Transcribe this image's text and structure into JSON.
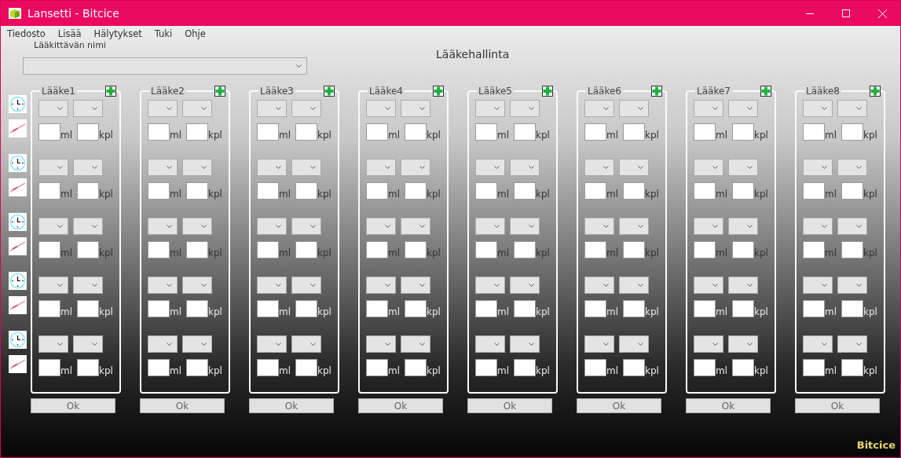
{
  "window": {
    "title": "Lansetti - Bitcice"
  },
  "menu": [
    "Tiedosto",
    "Lisää",
    "Hälytykset",
    "Tuki",
    "Ohje"
  ],
  "patient": {
    "label": "Lääkittävän nimi"
  },
  "heading": "Lääkehallinta",
  "medicines": [
    {
      "name": "Lääke1",
      "slots": [
        {
          "unit_1": "ml",
          "unit_2": "kpl"
        },
        {
          "unit_1": "ml",
          "unit_2": "kpl"
        },
        {
          "unit_1": "ml",
          "unit_2": "kpl"
        },
        {
          "unit_1": "ml",
          "unit_2": "kpl"
        },
        {
          "unit_1": "ml",
          "unit_2": "kpl"
        }
      ],
      "button": "Ok"
    },
    {
      "name": "Lääke2",
      "slots": [
        {
          "unit_1": "ml",
          "unit_2": "kpl"
        },
        {
          "unit_1": "ml",
          "unit_2": "kpl"
        },
        {
          "unit_1": "ml",
          "unit_2": "kpl"
        },
        {
          "unit_1": "ml",
          "unit_2": "kpl"
        },
        {
          "unit_1": "ml",
          "unit_2": "kpl"
        }
      ],
      "button": "Ok"
    },
    {
      "name": "Lääke3",
      "slots": [
        {
          "unit_1": "ml",
          "unit_2": "kpl"
        },
        {
          "unit_1": "ml",
          "unit_2": "kpl"
        },
        {
          "unit_1": "ml",
          "unit_2": "kpl"
        },
        {
          "unit_1": "ml",
          "unit_2": "kpl"
        },
        {
          "unit_1": "ml",
          "unit_2": "kpl"
        }
      ],
      "button": "Ok"
    },
    {
      "name": "Lääke4",
      "slots": [
        {
          "unit_1": "ml",
          "unit_2": "kpl"
        },
        {
          "unit_1": "ml",
          "unit_2": "kpl"
        },
        {
          "unit_1": "ml",
          "unit_2": "kpl"
        },
        {
          "unit_1": "ml",
          "unit_2": "kpl"
        },
        {
          "unit_1": "ml",
          "unit_2": "kpl"
        }
      ],
      "button": "Ok"
    },
    {
      "name": "Lääke5",
      "slots": [
        {
          "unit_1": "ml",
          "unit_2": "kpl"
        },
        {
          "unit_1": "ml",
          "unit_2": "kpl"
        },
        {
          "unit_1": "ml",
          "unit_2": "kpl"
        },
        {
          "unit_1": "ml",
          "unit_2": "kpl"
        },
        {
          "unit_1": "ml",
          "unit_2": "kpl"
        }
      ],
      "button": "Ok"
    },
    {
      "name": "Lääke6",
      "slots": [
        {
          "unit_1": "ml",
          "unit_2": "kpl"
        },
        {
          "unit_1": "ml",
          "unit_2": "kpl"
        },
        {
          "unit_1": "ml",
          "unit_2": "kpl"
        },
        {
          "unit_1": "ml",
          "unit_2": "kpl"
        },
        {
          "unit_1": "ml",
          "unit_2": "kpl"
        }
      ],
      "button": "Ok"
    },
    {
      "name": "Lääke7",
      "slots": [
        {
          "unit_1": "ml",
          "unit_2": "kpl"
        },
        {
          "unit_1": "ml",
          "unit_2": "kpl"
        },
        {
          "unit_1": "ml",
          "unit_2": "kpl"
        },
        {
          "unit_1": "ml",
          "unit_2": "kpl"
        },
        {
          "unit_1": "ml",
          "unit_2": "kpl"
        }
      ],
      "button": "Ok"
    },
    {
      "name": "Lääke8",
      "slots": [
        {
          "unit_1": "ml",
          "unit_2": "kpl"
        },
        {
          "unit_1": "ml",
          "unit_2": "kpl"
        },
        {
          "unit_1": "ml",
          "unit_2": "kpl"
        },
        {
          "unit_1": "ml",
          "unit_2": "kpl"
        },
        {
          "unit_1": "ml",
          "unit_2": "kpl"
        }
      ],
      "button": "Ok"
    }
  ],
  "footer": "Bitcice"
}
